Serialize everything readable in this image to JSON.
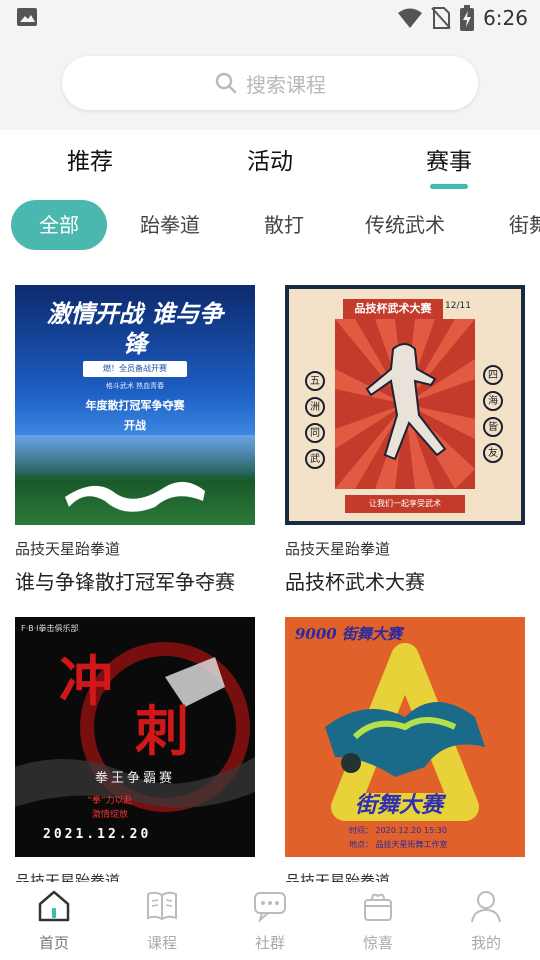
{
  "status_bar": {
    "time": "6:26"
  },
  "search": {
    "placeholder": "搜索课程"
  },
  "top_tabs": [
    {
      "label": "推荐"
    },
    {
      "label": "活动"
    },
    {
      "label": "赛事",
      "active": true
    }
  ],
  "categories": [
    {
      "label": "全部",
      "active": true
    },
    {
      "label": "跆拳道"
    },
    {
      "label": "散打"
    },
    {
      "label": "传统武术"
    },
    {
      "label": "街舞"
    }
  ],
  "cards": [
    {
      "org": "品技天星跆拳道",
      "title": "谁与争锋散打冠军争夺赛",
      "poster": {
        "headline": "激情开战 谁与争锋",
        "tagline": "燃！全员备战开赛",
        "sub": "格斗武术 热血青春",
        "line1": "年度散打冠军争夺赛",
        "line2": "开战"
      }
    },
    {
      "org": "品技天星跆拳道",
      "title": "品技杯武术大赛",
      "poster": {
        "headline": "品技杯武术大赛",
        "date": "12/11",
        "left_chars": [
          "五",
          "洲",
          "同",
          "武"
        ],
        "right_chars": [
          "四",
          "海",
          "皆",
          "友"
        ],
        "footer": "让我们一起享受武术"
      }
    },
    {
      "org": "品技天星跆拳道",
      "title": "",
      "poster": {
        "club": "F·B·I拳击俱乐部",
        "big1": "冲",
        "big2": "刺",
        "sub": "拳王争霸赛",
        "slogan1": "“拳”力以赴",
        "slogan2": "激情绽放",
        "date": "2021.12.20"
      }
    },
    {
      "org": "品技天星跆拳道",
      "title": "",
      "poster": {
        "top": "9000 街舞大赛",
        "main": "街舞大赛",
        "time_label": "时间：",
        "time_value": "2020.12.20 15:30",
        "place_label": "地点：",
        "place_value": "品技天星街舞工作室"
      }
    }
  ],
  "bottom_nav": [
    {
      "label": "首页",
      "icon": "home-icon",
      "active": true
    },
    {
      "label": "课程",
      "icon": "book-icon"
    },
    {
      "label": "社群",
      "icon": "chat-icon"
    },
    {
      "label": "惊喜",
      "icon": "gift-icon"
    },
    {
      "label": "我的",
      "icon": "profile-icon"
    }
  ],
  "colors": {
    "accent": "#4bb8b0",
    "tab_underline": "#3dbcb1"
  }
}
